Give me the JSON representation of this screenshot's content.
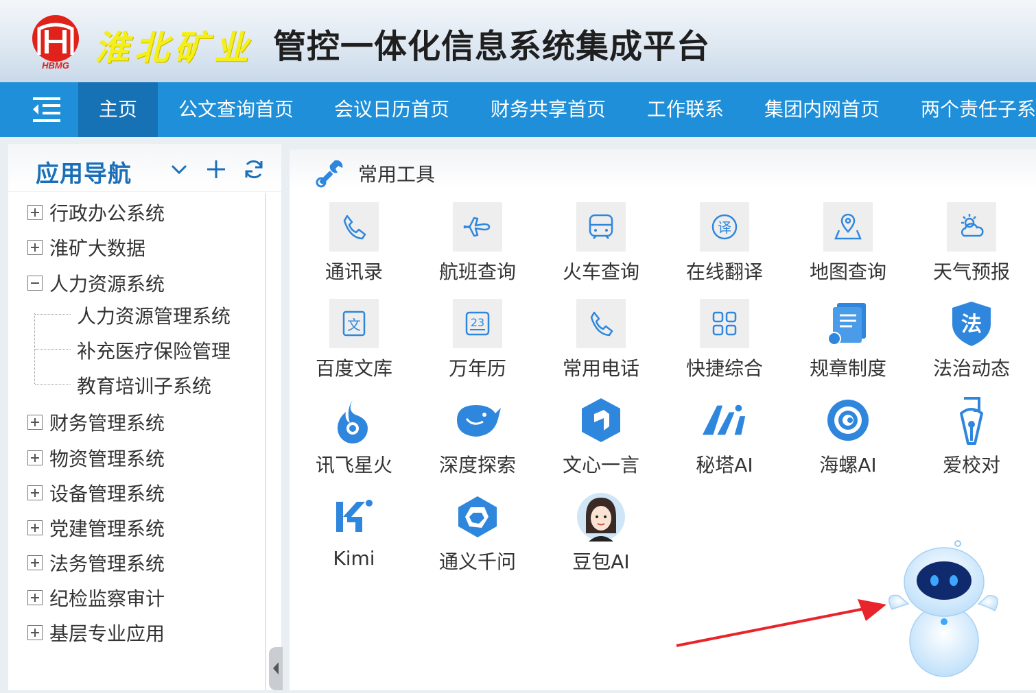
{
  "header": {
    "logo_text": "HBMG",
    "company_name": "淮北矿业",
    "platform_title": "管控一体化信息系统集成平台"
  },
  "navbar": {
    "items": [
      {
        "label": "主页",
        "active": true
      },
      {
        "label": "公文查询首页"
      },
      {
        "label": "会议日历首页"
      },
      {
        "label": "财务共享首页"
      },
      {
        "label": "工作联系"
      },
      {
        "label": "集团内网首页"
      },
      {
        "label": "两个责任子系"
      }
    ]
  },
  "sidebar": {
    "title": "应用导航",
    "tree": [
      {
        "label": "行政办公系统",
        "expanded": false
      },
      {
        "label": "淮矿大数据",
        "expanded": false
      },
      {
        "label": "人力资源系统",
        "expanded": true,
        "children": [
          "人力资源管理系统",
          "补充医疗保险管理",
          "教育培训子系统"
        ]
      },
      {
        "label": "财务管理系统",
        "expanded": false
      },
      {
        "label": "物资管理系统",
        "expanded": false
      },
      {
        "label": "设备管理系统",
        "expanded": false
      },
      {
        "label": "党建管理系统",
        "expanded": false
      },
      {
        "label": "法务管理系统",
        "expanded": false
      },
      {
        "label": "纪检监察审计",
        "expanded": false
      },
      {
        "label": "基层专业应用",
        "expanded": false
      }
    ]
  },
  "main": {
    "section_title": "常用工具",
    "tools": [
      {
        "label": "通讯录",
        "icon": "phone-icon"
      },
      {
        "label": "航班查询",
        "icon": "plane-icon"
      },
      {
        "label": "火车查询",
        "icon": "train-icon"
      },
      {
        "label": "在线翻译",
        "icon": "translate-icon"
      },
      {
        "label": "地图查询",
        "icon": "map-icon"
      },
      {
        "label": "天气预报",
        "icon": "weather-icon"
      },
      {
        "label": "百度文库",
        "icon": "document-icon",
        "glyph": "文"
      },
      {
        "label": "万年历",
        "icon": "calendar-icon",
        "glyph": "23"
      },
      {
        "label": "常用电话",
        "icon": "phone-icon"
      },
      {
        "label": "快捷综合",
        "icon": "grid-icon"
      },
      {
        "label": "规章制度",
        "icon": "rules-book-icon"
      },
      {
        "label": "法治动态",
        "icon": "law-shield-icon",
        "glyph": "法"
      },
      {
        "label": "讯飞星火",
        "icon": "spark-flame-icon"
      },
      {
        "label": "深度探索",
        "icon": "whale-icon"
      },
      {
        "label": "文心一言",
        "icon": "hexagon-cube-icon"
      },
      {
        "label": "秘塔AI",
        "icon": "metaso-icon"
      },
      {
        "label": "海螺AI",
        "icon": "snail-icon"
      },
      {
        "label": "爱校对",
        "icon": "proofread-icon"
      },
      {
        "label": "Kimi",
        "icon": "kimi-icon"
      },
      {
        "label": "通义千问",
        "icon": "tongyi-icon"
      },
      {
        "label": "豆包AI",
        "icon": "doubao-avatar-icon"
      }
    ]
  },
  "colors": {
    "nav_bg": "#1e8fd8",
    "nav_active": "#1672b4",
    "accent_blue": "#1b6fb8",
    "icon_blue": "#2f86dd",
    "logo_red": "#e0221a",
    "logo_yellow": "#f5ef18",
    "arrow_red": "#e8252a"
  }
}
